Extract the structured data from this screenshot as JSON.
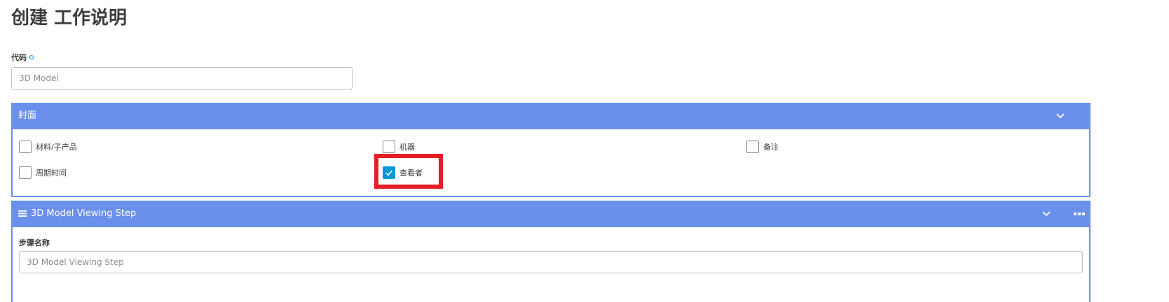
{
  "page": {
    "title": "创建 工作说明"
  },
  "code_field": {
    "label": "代码",
    "placeholder": "3D Model"
  },
  "cover_panel": {
    "title": "封面",
    "checkboxes": [
      {
        "label": "材料/子产品",
        "checked": false
      },
      {
        "label": "机器",
        "checked": false
      },
      {
        "label": "备注",
        "checked": false
      },
      {
        "label": "周期时间",
        "checked": false
      },
      {
        "label": "查看者",
        "checked": true
      }
    ]
  },
  "step_panel": {
    "title": "3D Model Viewing Step",
    "step_name_label": "步骤名称",
    "step_name_placeholder": "3D Model Viewing Step"
  },
  "colors": {
    "accent": "#6a90ec",
    "checkbox_checked": "#0696d7",
    "highlight": "#e31e24"
  }
}
